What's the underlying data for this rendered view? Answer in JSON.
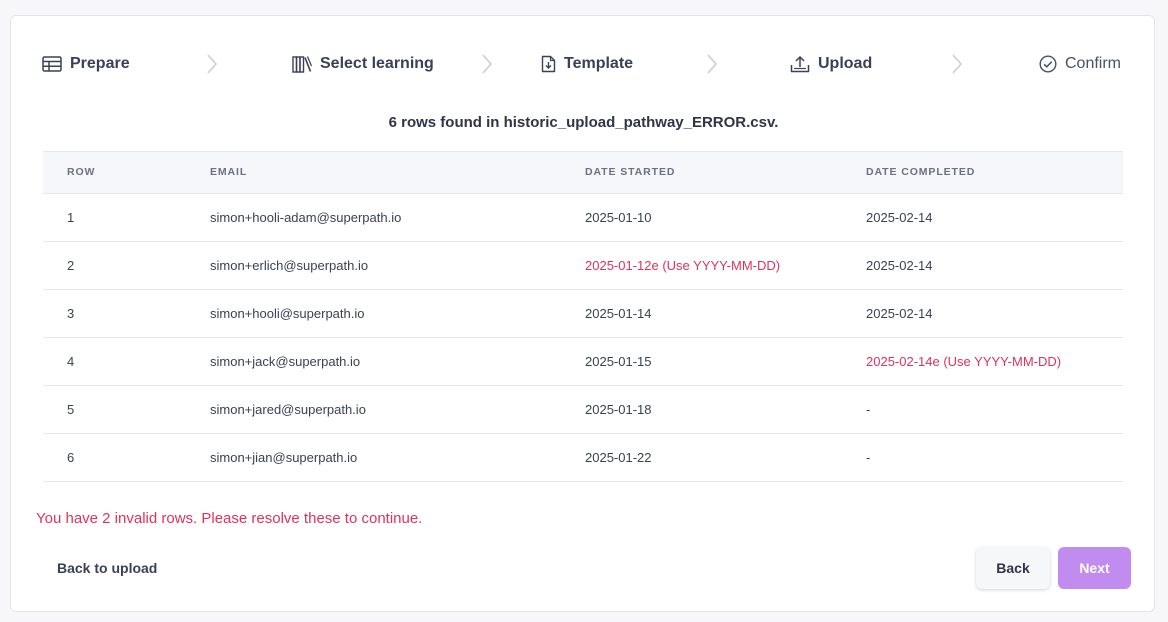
{
  "stepper": {
    "steps": [
      {
        "label": "Prepare",
        "icon": "table-icon"
      },
      {
        "label": "Select learning",
        "icon": "books-icon"
      },
      {
        "label": "Template",
        "icon": "file-download-icon"
      },
      {
        "label": "Upload",
        "icon": "upload-icon"
      },
      {
        "label": "Confirm",
        "icon": "check-circle-icon"
      }
    ]
  },
  "summary": "6 rows found in historic_upload_pathway_ERROR.csv.",
  "table": {
    "headers": {
      "row": "ROW",
      "email": "EMAIL",
      "date_started": "DATE STARTED",
      "date_completed": "DATE COMPLETED"
    },
    "rows": [
      {
        "row": "1",
        "email": "simon+hooli-adam@superpath.io",
        "date_started": "2025-01-10",
        "date_completed": "2025-02-14"
      },
      {
        "row": "2",
        "email": "simon+erlich@superpath.io",
        "date_started": "2025-01-12e (Use YYYY-MM-DD)",
        "date_completed": "2025-02-14"
      },
      {
        "row": "3",
        "email": "simon+hooli@superpath.io",
        "date_started": "2025-01-14",
        "date_completed": "2025-02-14"
      },
      {
        "row": "4",
        "email": "simon+jack@superpath.io",
        "date_started": "2025-01-15",
        "date_completed": "2025-02-14e (Use YYYY-MM-DD)"
      },
      {
        "row": "5",
        "email": "simon+jared@superpath.io",
        "date_started": "2025-01-18",
        "date_completed": "-"
      },
      {
        "row": "6",
        "email": "simon+jian@superpath.io",
        "date_started": "2025-01-22",
        "date_completed": "-"
      }
    ]
  },
  "error_message": "You have 2 invalid rows. Please resolve these to continue.",
  "footer": {
    "back_to_upload": "Back to upload",
    "back": "Back",
    "next": "Next"
  },
  "colors": {
    "error": "#e0325f",
    "primary": "#c08cf0",
    "header_bg": "#f5f7fa"
  }
}
